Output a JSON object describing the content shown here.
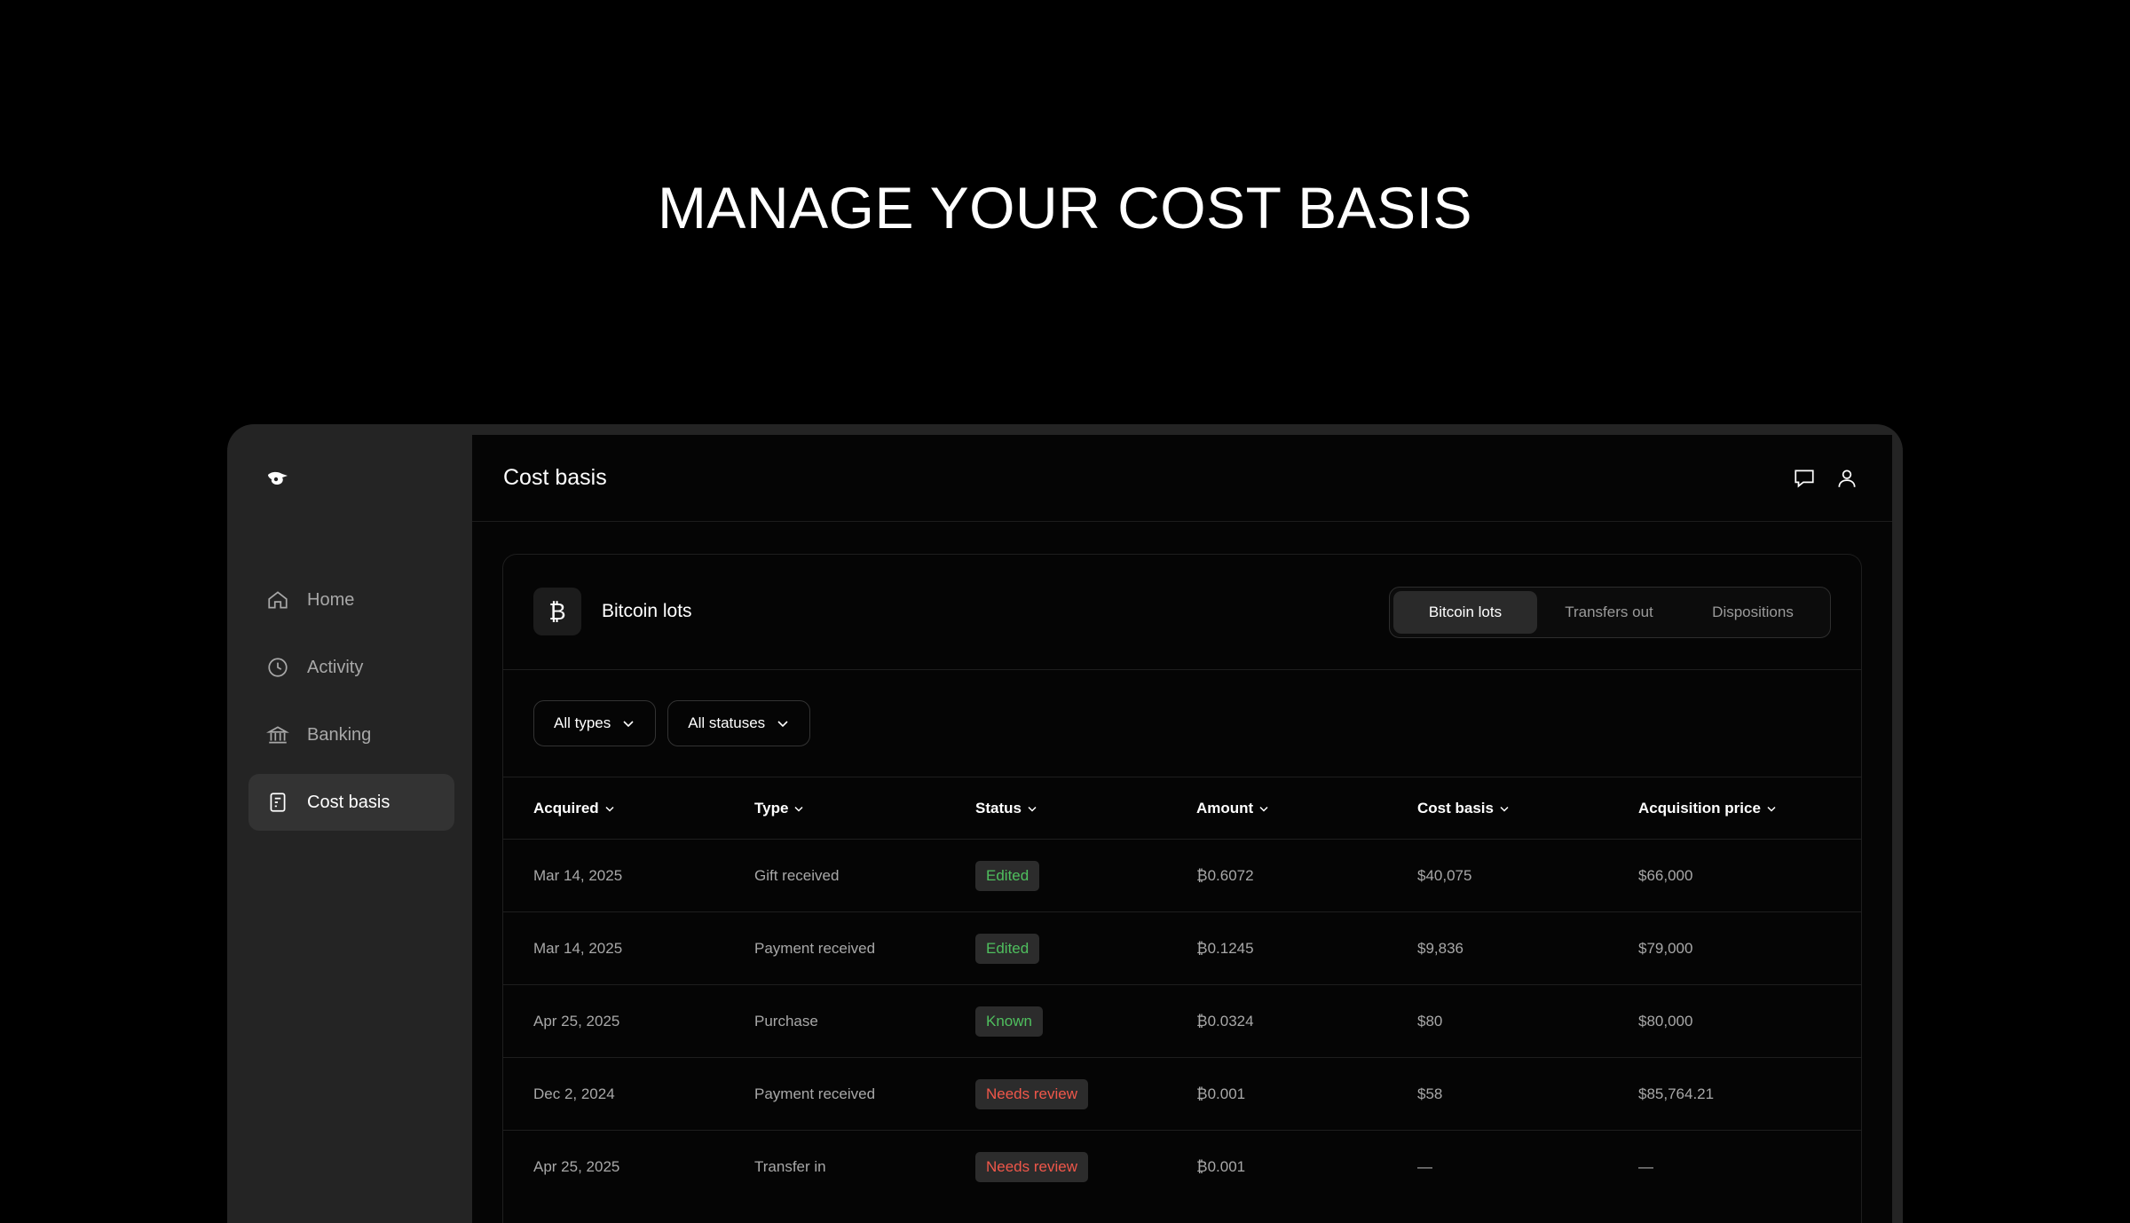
{
  "headline": "MANAGE YOUR COST BASIS",
  "sidebar": {
    "items": [
      {
        "label": "Home",
        "icon": "home-icon"
      },
      {
        "label": "Activity",
        "icon": "clock-icon"
      },
      {
        "label": "Banking",
        "icon": "bank-icon"
      },
      {
        "label": "Cost basis",
        "icon": "document-icon",
        "active": true
      }
    ]
  },
  "header": {
    "title": "Cost basis"
  },
  "card": {
    "badge": "₿",
    "title": "Bitcoin lots",
    "tabs": [
      "Bitcoin lots",
      "Transfers out",
      "Dispositions"
    ],
    "active_tab": "Bitcoin lots"
  },
  "filters": [
    "All types",
    "All statuses"
  ],
  "table": {
    "columns": [
      "Acquired",
      "Type",
      "Status",
      "Amount",
      "Cost basis",
      "Acquisition price"
    ],
    "rows": [
      {
        "acquired": "Mar 14, 2025",
        "type": "Gift received",
        "status": "Edited",
        "amount": "₿0.6072",
        "cost_basis": "$40,075",
        "price": "$66,000"
      },
      {
        "acquired": "Mar 14, 2025",
        "type": "Payment received",
        "status": "Edited",
        "amount": "₿0.1245",
        "cost_basis": "$9,836",
        "price": "$79,000"
      },
      {
        "acquired": "Apr 25, 2025",
        "type": "Purchase",
        "status": "Known",
        "amount": "₿0.0324",
        "cost_basis": "$80",
        "price": "$80,000"
      },
      {
        "acquired": "Dec 2, 2024",
        "type": "Payment received",
        "status": "Needs review",
        "amount": "₿0.001",
        "cost_basis": "$58",
        "price": "$85,764.21"
      },
      {
        "acquired": "Apr 25, 2025",
        "type": "Transfer in",
        "status": "Needs review",
        "amount": "₿0.001",
        "cost_basis": "—",
        "price": "—"
      }
    ]
  },
  "colors": {
    "status_edited": "#4fbf5e",
    "status_known": "#4fbf5e",
    "status_needs_review": "#f0574a"
  }
}
